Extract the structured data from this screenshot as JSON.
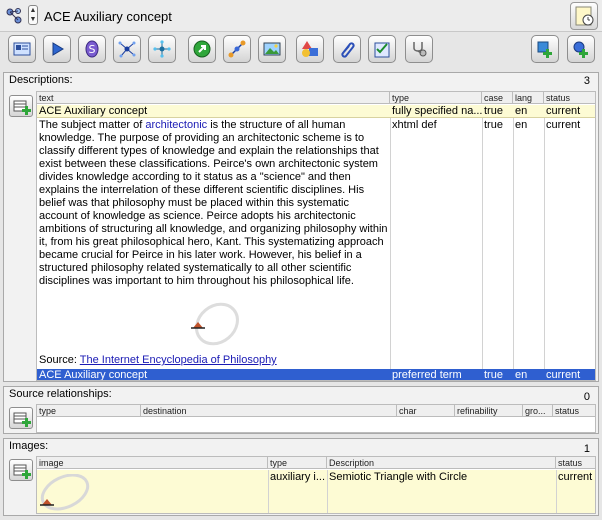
{
  "header": {
    "title": "ACE Auxiliary concept"
  },
  "toolbar": {
    "buttons": [
      "concept-view-icon",
      "play-icon",
      "shortcut-icon",
      "taxonomy-icon",
      "hierarchy-icon",
      "go-icon",
      "relationship-icon",
      "image-icon",
      "shapes-icon",
      "attachment-icon",
      "checklist-icon",
      "stethoscope-icon",
      "add-concept-icon",
      "add-child-icon"
    ]
  },
  "descriptions": {
    "title": "Descriptions:",
    "count": "3",
    "columns": [
      "text",
      "type",
      "case",
      "lang",
      "status"
    ],
    "rows": [
      {
        "text": "ACE Auxiliary concept",
        "type": "fully specified na...",
        "case": "true",
        "lang": "en",
        "status": "current"
      },
      {
        "type": "xhtml def",
        "case": "true",
        "lang": "en",
        "status": "current"
      },
      {
        "text": "ACE Auxiliary concept",
        "type": "preferred term",
        "case": "true",
        "lang": "en",
        "status": "current"
      }
    ],
    "def_before": "The subject matter of ",
    "def_link": "architectonic",
    "def_after": " is the structure of all human knowledge. The purpose of providing an architectonic scheme is to classify different types of knowledge and explain the relationships that exist between these classifications. Peirce's own architectonic system divides knowledge according to it status as a \"science\" and then explains the interrelation of these different scientific disciplines. His belief was that philosophy must be placed within this systematic account of knowledge as science. Peirce adopts his architectonic ambitions of structuring all knowledge, and organizing philosophy within it, from his great philosophical hero, Kant. This systematizing approach became crucial for Peirce in his later work. However, his belief in a structured philosophy related systematically to all other scientific disciplines was important to him throughout his philosophical life.",
    "source_label": "Source: ",
    "source_link": "The Internet Encyclopedia of Philosophy"
  },
  "source_relationships": {
    "title": "Source relationships:",
    "count": "0",
    "columns": [
      "type",
      "destination",
      "char",
      "refinability",
      "gro...",
      "status"
    ]
  },
  "images": {
    "title": "Images:",
    "count": "1",
    "columns": [
      "image",
      "type",
      "Description",
      "status"
    ],
    "rows": [
      {
        "type": "auxiliary i...",
        "description": "Semiotic Triangle with Circle",
        "status": "current"
      }
    ]
  },
  "colors": {
    "selected_row": "#2f5fd0",
    "highlight_row": "#fdfbd4"
  }
}
